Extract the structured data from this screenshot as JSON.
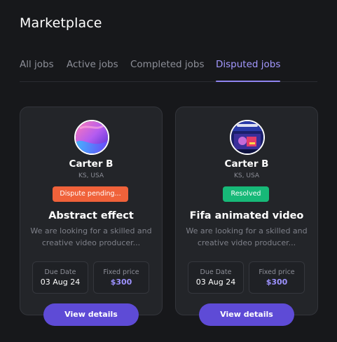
{
  "page": {
    "title": "Marketplace"
  },
  "tabs": [
    {
      "label": "All jobs"
    },
    {
      "label": "Active jobs"
    },
    {
      "label": "Completed jobs"
    },
    {
      "label": "Disputed jobs",
      "active": true
    }
  ],
  "cards": [
    {
      "name": "Carter B",
      "location": "KS, USA",
      "status": "Dispute pending...",
      "status_color": "#f0623a",
      "title": "Abstract effect",
      "description": "We are looking for a skilled and creative video producer...",
      "due_label": "Due Date",
      "due_value": "03 Aug 24",
      "price_label": "Fixed price",
      "price_value": "$300",
      "button": "View details"
    },
    {
      "name": "Carter B",
      "location": "KS, USA",
      "status": "Resolved",
      "status_color": "#17b978",
      "title": "Fifa animated video",
      "description": "We are looking for a skilled and creative video producer...",
      "due_label": "Due Date",
      "due_value": "03 Aug 24",
      "price_label": "Fixed price",
      "price_value": "$300",
      "button": "View details"
    }
  ],
  "colors": {
    "accent": "#5e4bd6",
    "tab_active": "#a398ff",
    "background": "#17181b",
    "card": "#232529"
  }
}
